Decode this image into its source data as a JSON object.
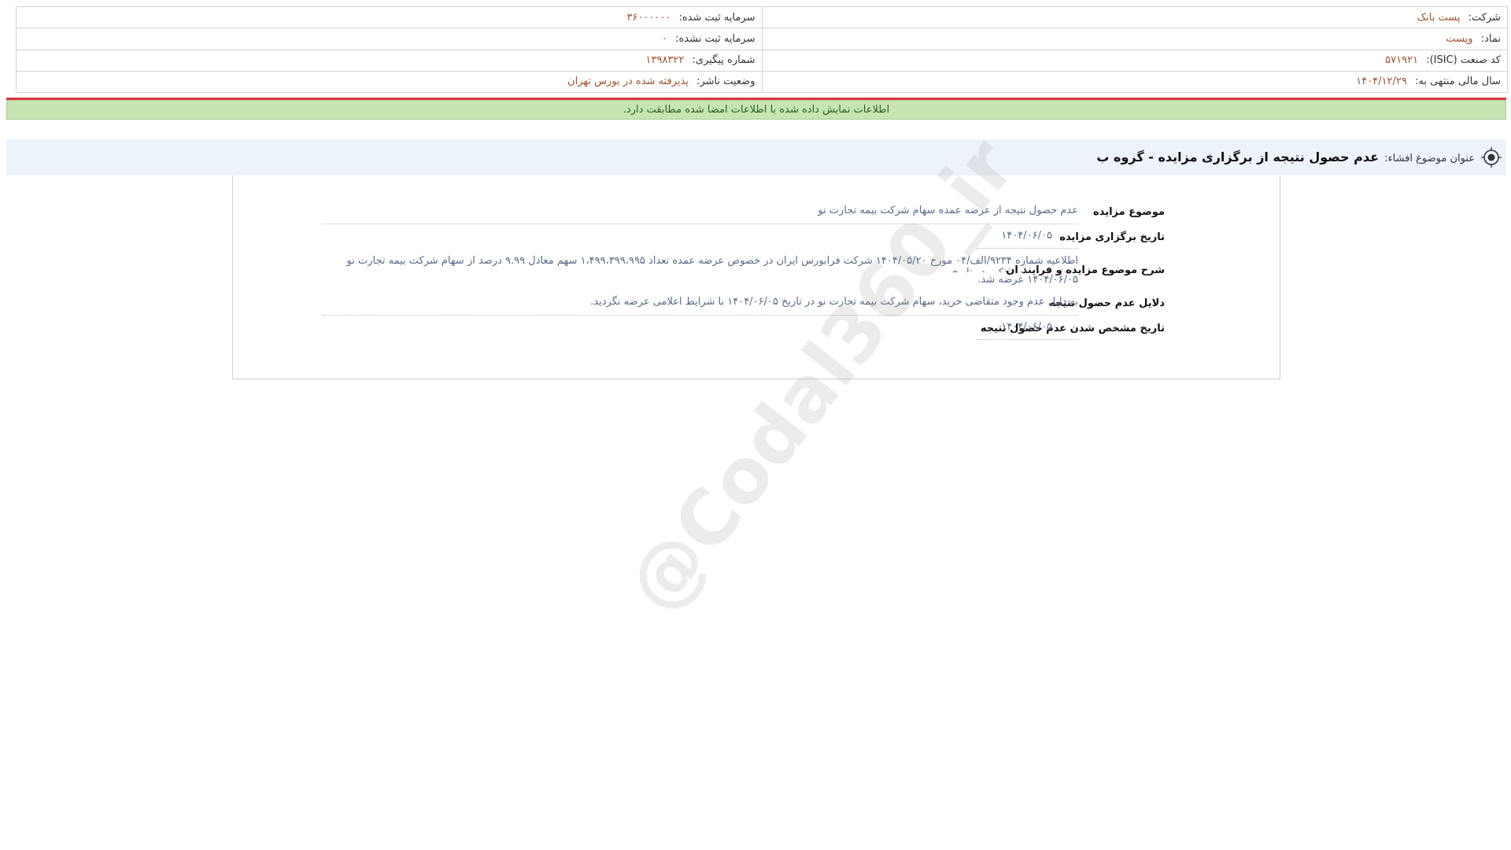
{
  "company_info": {
    "company_label": "شرکت:",
    "company_value": "پست بانک",
    "symbol_label": "نماد:",
    "symbol_value": "وپست",
    "isic_label": "کد صنعت (ISIC):",
    "isic_value": "۵۷۱۹۲۱",
    "fiscal_year_label": "سال مالی منتهی به:",
    "fiscal_year_value": "۱۴۰۴/۱۲/۲۹",
    "registered_capital_label": "سرمایه ثبت شده:",
    "registered_capital_value": "۳۶۰۰۰۰۰۰",
    "unregistered_capital_label": "سرمایه ثبت نشده:",
    "unregistered_capital_value": "۰",
    "tracking_label": "شماره پیگیری:",
    "tracking_value": "۱۳۹۸۳۲۲",
    "publisher_status_label": "وضعیت ناشر:",
    "publisher_status_value": "پذیرفته شده در بورس تهران"
  },
  "banner": {
    "text": "اطلاعات نمایش داده شده با اطلاعات امضا شده مطابقت دارد."
  },
  "title": {
    "label": "عنوان موضوع افشاء:",
    "value": "عدم حصول نتیجه از برگزاری مزایده - گروه ب"
  },
  "details": {
    "subject_label": "موضوع مزایده",
    "subject_value": "عدم حصول نتیجه از عرضه عمده سهام شرکت بیمه تجارت نو",
    "date_label": "تاریخ برگزاری مزایده",
    "date_value": "۱۴۰۴/۰۶/۰۵",
    "description_label": "شرح موضوع مزایده و فرایند ان",
    "description_line1": "اطلاعیه شماره ۹۲۳۴/الف/۰۴ مورخ ۱۴۰۴/۰۵/۲۰ شرکت فرابورس ایران در خصوص عرضه عمده تعداد ۱،۴۹۹،۳۹۹،۹۹۵ سهم معادل ۹.۹۹ درصد از سهام شرکت بیمه تجارت نو منتشر و سهام مذکور در تاریخ",
    "description_line2": "۱۴۰۴/۰۶/۰۵ عرضه شد.",
    "reasons_label": "دلایل عدم حصول نتیجه",
    "reasons_value": "به دلیل عدم وجود متقاضی خرید، سهام شرکت بیمه تجارت نو در تاریخ ۱۴۰۴/۰۶/۰۵ با شرایط اعلامی عرضه نگردید.",
    "result_date_label": "تاریخ مشخص شدن عدم حصول نتیجه",
    "result_date_value": "۱۴۰۴/۰۶/۰۵"
  },
  "watermark": {
    "text": "@Codal360_ir"
  }
}
